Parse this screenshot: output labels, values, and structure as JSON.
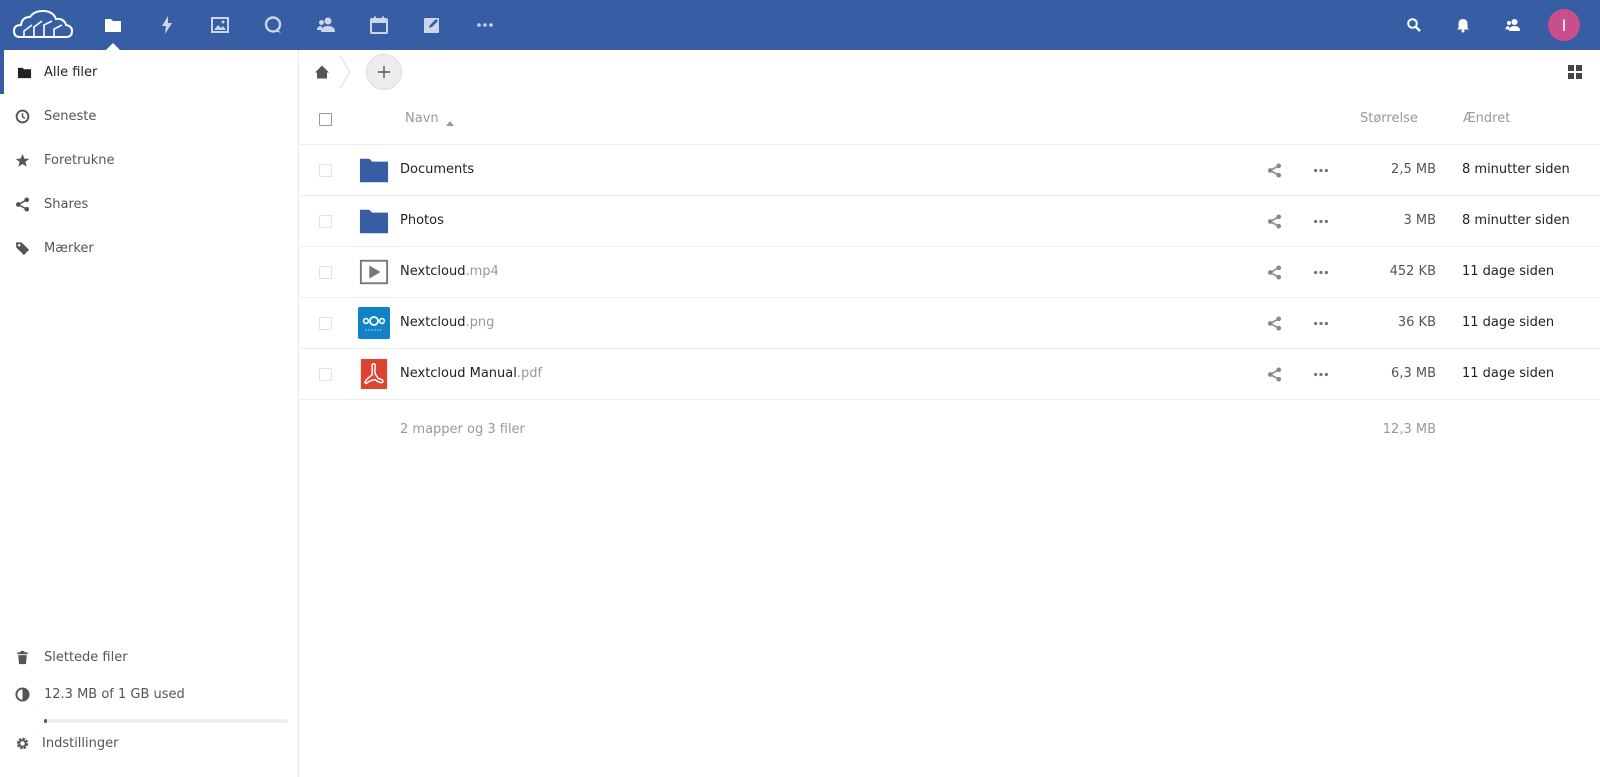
{
  "header": {
    "apps": [
      {
        "name": "files",
        "icon": "folder-icon"
      },
      {
        "name": "activity",
        "icon": "lightning-icon"
      },
      {
        "name": "gallery",
        "icon": "image-icon"
      },
      {
        "name": "talk",
        "icon": "chat-bubble-icon"
      },
      {
        "name": "contacts",
        "icon": "contacts-icon"
      },
      {
        "name": "calendar",
        "icon": "calendar-icon"
      },
      {
        "name": "notes",
        "icon": "edit-icon"
      },
      {
        "name": "more-apps",
        "icon": "more-horizontal-icon"
      }
    ],
    "avatar_initial": "I",
    "avatar_color": "#c94f8c",
    "brand_color": "#375ea4"
  },
  "sidebar": {
    "items": [
      {
        "label": "Alle filer",
        "icon": "folder-icon",
        "active": true
      },
      {
        "label": "Seneste",
        "icon": "clock-icon"
      },
      {
        "label": "Foretrukne",
        "icon": "star-icon"
      },
      {
        "label": "Shares",
        "icon": "share-icon"
      },
      {
        "label": "Mærker",
        "icon": "tag-icon"
      }
    ],
    "bottom": {
      "trash_label": "Slettede filer",
      "quota_label": "12.3 MB of 1 GB used",
      "quota_fraction": 0.012,
      "settings_label": "Indstillinger"
    }
  },
  "table": {
    "headers": {
      "name": "Navn",
      "size": "Størrelse",
      "modified": "Ændret"
    },
    "rows": [
      {
        "base": "Documents",
        "ext": "",
        "type": "folder",
        "size": "2,5 MB",
        "modified": "8 minutter siden"
      },
      {
        "base": "Photos",
        "ext": "",
        "type": "folder",
        "size": "3 MB",
        "modified": "8 minutter siden"
      },
      {
        "base": "Nextcloud",
        "ext": ".mp4",
        "type": "video",
        "size": "452 KB",
        "modified": "11 dage siden"
      },
      {
        "base": "Nextcloud",
        "ext": ".png",
        "type": "image",
        "size": "36 KB",
        "modified": "11 dage siden"
      },
      {
        "base": "Nextcloud Manual",
        "ext": ".pdf",
        "type": "pdf",
        "size": "6,3 MB",
        "modified": "11 dage siden"
      }
    ],
    "summary": {
      "text": "2 mapper og 3 filer",
      "size": "12,3 MB"
    }
  }
}
